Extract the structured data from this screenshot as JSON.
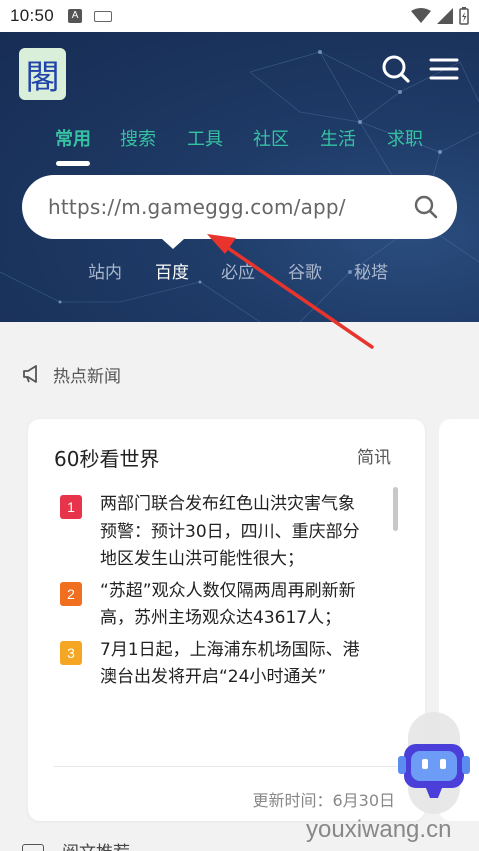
{
  "status_bar": {
    "time": "10:50",
    "notif_letter": "A"
  },
  "header": {
    "logo_char": "閣",
    "tabs": [
      "常用",
      "搜索",
      "工具",
      "社区",
      "生活",
      "求职"
    ],
    "search": {
      "value": "https://m.gameggg.com/app/"
    },
    "engines": [
      "站内",
      "百度",
      "必应",
      "谷歌",
      "秘塔"
    ],
    "active_engine_index": 1
  },
  "news": {
    "section_title": "热点新闻",
    "card": {
      "title": "60秒看世界",
      "tag": "简讯",
      "items": [
        {
          "num": "1",
          "color": "#e8344a",
          "text": "两部门联合发布红色山洪灾害气象预警：预计30日，四川、重庆部分地区发生山洪可能性很大；"
        },
        {
          "num": "2",
          "color": "#f07020",
          "text": "“苏超”观众人数仅隔两周再刷新新高，苏州主场观众达43617人；"
        },
        {
          "num": "3",
          "color": "#f5a623",
          "text": "7月1日起，上海浦东机场国际、港澳台出发将开启“24小时通关”"
        }
      ],
      "update_time": "更新时间：6月30日"
    }
  },
  "bottom": {
    "next_section": "阅文推荐"
  },
  "watermark": "youxiwang.cn",
  "colors": {
    "accent": "#36c2a2",
    "header_bg": "#1e3a66",
    "arrow": "#e8342c"
  }
}
